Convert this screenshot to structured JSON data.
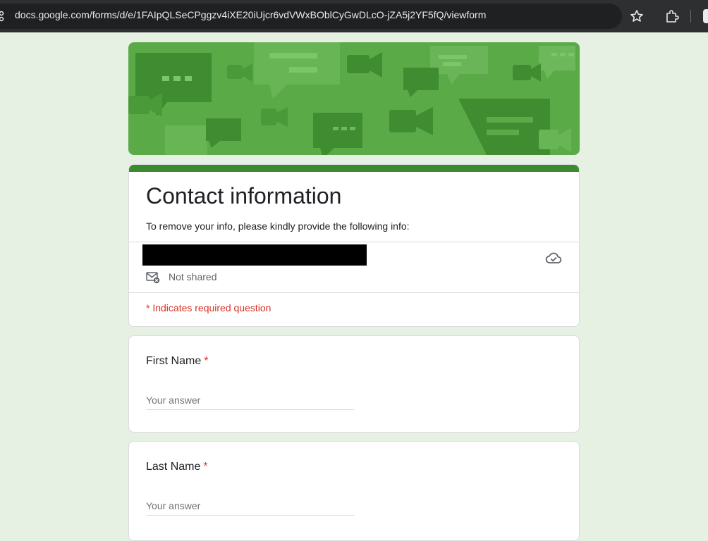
{
  "browser": {
    "url": "docs.google.com/forms/d/e/1FAIpQLSeCPggzv4iXE20iUjcr6vdVWxBOblCyGwDLcO-jZA5j2YF5fQ/viewform"
  },
  "form": {
    "title": "Contact information",
    "description": "To remove your info, please kindly provide the following info:",
    "email_status": "Not shared",
    "required_note": "* Indicates required question",
    "questions": [
      {
        "label": "First Name",
        "required_mark": "*",
        "placeholder": "Your answer"
      },
      {
        "label": "Last Name",
        "required_mark": "*",
        "placeholder": "Your answer"
      }
    ]
  },
  "colors": {
    "page_background": "#e6f0e3",
    "theme_accent": "#3b8a30",
    "header_green": "#5aab48",
    "required_red": "#d93025"
  },
  "icons": [
    "site-info-icon",
    "bookmark-star-icon",
    "extensions-icon",
    "profile-icon",
    "mail-not-shared-icon",
    "cloud-saved-icon"
  ]
}
